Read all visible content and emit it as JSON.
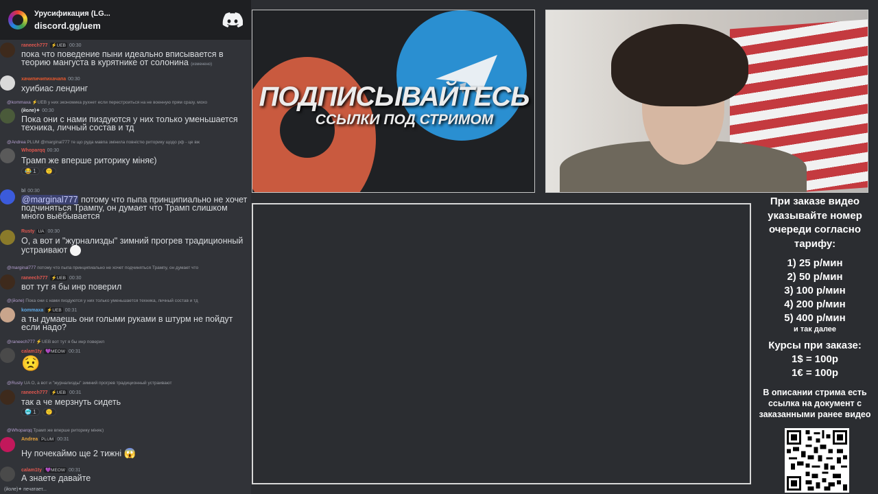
{
  "chat": {
    "server_name": "Урусификация (LG...",
    "server_invite": "discord.gg/uem",
    "typing": "(йоле)✦ печатает...",
    "messages": [
      {
        "user": "raneech777",
        "tag": "⚡UEB",
        "time": "00:30",
        "text": "пока что поведение пыни идеально вписывается в теорию мангуста в курятнике от солонина",
        "edited": "(изменено)"
      },
      {
        "user": "хачипичипихачапа",
        "time": "00:30",
        "text": "хуибиас лендинг"
      },
      {
        "reply_user": "@kommaxa",
        "reply_text": "⚡UEB у них экономика рухнет если перестроиться на не военную прям сразу. мохо",
        "user": "(йоле)✦",
        "time": "00:30",
        "text": "Пока они с нами пиздуются у них только уменьшается техника, личный состав и тд"
      },
      {
        "reply_user": "@Andrea",
        "reply_text": "PLUM @marginal777 те що руда мавпа змінила повністю риторику щодо рф - це вж",
        "user": "Whoparqq",
        "time": "00:30",
        "text": "Трамп же вперше риторику міняє)",
        "reactions": [
          "😂 1",
          "🙂"
        ]
      },
      {
        "user": "bl",
        "time": "00:30",
        "mention": "@marginal777",
        "text": " потому что пыпа принципиально не хочет подчиняться Трампу, он думает что Трамп слишком много выёбывается"
      },
      {
        "user": "Rusty",
        "tag": "UA",
        "time": "00:30",
        "text": "О, а вот и \"журнализды\" зимний прогрев традиционный устраивают"
      },
      {
        "reply_user": "@marginal777",
        "reply_text": "потому что пыпа принципиально не хочет подчиняться Трампу, он думает что",
        "user": "raneech777",
        "tag": "⚡UEB",
        "time": "00:30",
        "text": "вот тут я бы инр поверил"
      },
      {
        "reply_user": "@(йоле)",
        "reply_text": "Пока они с нами пиздуются у них только уменьшается техника, личный состав и тд",
        "user": "kommaxa",
        "tag": "⚡UEB",
        "time": "00:31",
        "text": "а ты думаешь они голыми руками в штурм не пойдут если надо?"
      },
      {
        "reply_user": "@raneech777",
        "reply_text": "⚡UEB вот тут я бы инр поверил",
        "user": "calam1ty",
        "tag": "💜MEOW",
        "time": "00:31",
        "emoji": "😟"
      },
      {
        "reply_user": "@Rusty",
        "reply_text": "UA О, а вот и \"журнализды\" зимний прогрев традиционный устраивают",
        "user": "raneech777",
        "tag": "⚡UEB",
        "time": "00:31",
        "text": "так а че мерзнуть сидеть",
        "reactions": [
          "🥶 1",
          "🙂"
        ]
      },
      {
        "reply_user": "@Whoparqq",
        "reply_text": "Трамп же вперше риторику міняє)",
        "user": "Andrea",
        "tag": "PLUM",
        "time": "00:31",
        "text": "Ну почекаймо ще 2 тижні"
      },
      {
        "user": "calam1ty",
        "tag": "💜MEOW",
        "time": "00:31",
        "text": "А знаете давайте"
      }
    ]
  },
  "promo": {
    "title": "ПОДПИСЫВАЙТЕСЬ",
    "subtitle": "ССЫЛКИ ПОД СТРИМОМ"
  },
  "info": {
    "head": "При заказе видео указывайте номер очереди согласно тарифу:",
    "tariffs": [
      "1) 25 р/мин",
      "2) 50 р/мин",
      "3) 100 р/мин",
      "4) 200 р/мин",
      "5) 400 р/мин"
    ],
    "more": "и так далее",
    "rates_head": "Курсы при заказе:",
    "rates": [
      "1$ = 100р",
      "1€ = 100р"
    ],
    "doc_note": "В описании стрима есть ссылка на документ с заказанными ранее видео"
  }
}
